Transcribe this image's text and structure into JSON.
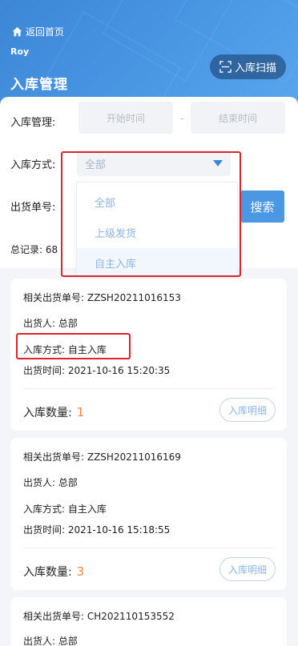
{
  "header": {
    "back_label": "返回首页",
    "user_name": "Roy",
    "page_title": "入库管理",
    "scan_label": "入库扫描"
  },
  "filter": {
    "date_label": "入库管理:",
    "start_placeholder": "开始时间",
    "date_separator": "-",
    "end_placeholder": "结束时间",
    "method_label": "入库方式:",
    "method_selected": "全部",
    "shipment_label": "出货单号:",
    "search_label": "搜索",
    "total_label": "总记录: 68"
  },
  "dropdown": {
    "options": [
      "全部",
      "上级发货",
      "自主入库"
    ]
  },
  "cards": [
    {
      "order": "相关出货单号: ZZSH20211016153",
      "shipper": "出货人: 总部",
      "method": "入库方式: 自主入库",
      "time": "出货时间: 2021-10-16 15:20:35",
      "qty_label": "入库数量:",
      "qty": "1",
      "detail_label": "入库明细"
    },
    {
      "order": "相关出货单号: ZZSH20211016169",
      "shipper": "出货人: 总部",
      "method": "入库方式: 自主入库",
      "time": "出货时间: 2021-10-16 15:18:55",
      "qty_label": "入库数量:",
      "qty": "3",
      "detail_label": "入库明细"
    },
    {
      "order": "相关出货单号: CH202110153552",
      "shipper": "出货人: 总部"
    }
  ],
  "colors": {
    "primary": "#4a97e4",
    "accent_orange": "#f08a3c",
    "highlight_red": "#d9262c"
  }
}
